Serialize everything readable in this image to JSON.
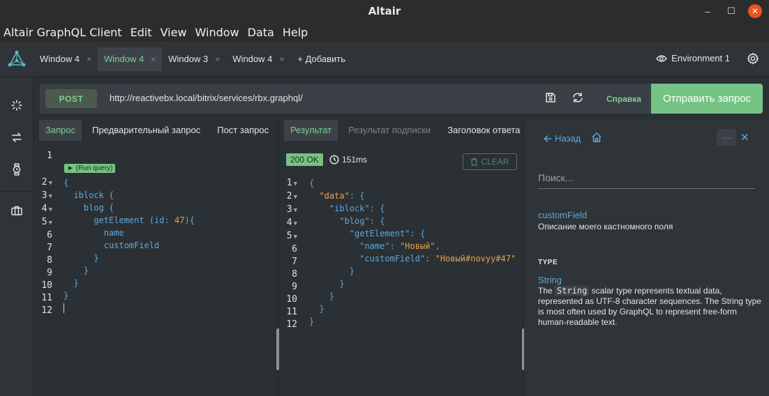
{
  "window": {
    "title": "Altair",
    "minimize": "–",
    "maximize": "☐",
    "close": "✕"
  },
  "menu": [
    "Altair GraphQL Client",
    "Edit",
    "View",
    "Window",
    "Data",
    "Help"
  ],
  "tabs": [
    {
      "label": "Window 4",
      "active": false
    },
    {
      "label": "Window 4",
      "active": true
    },
    {
      "label": "Window 3",
      "active": false
    },
    {
      "label": "Window 4",
      "active": false
    }
  ],
  "tab_close": "×",
  "add_tab": "+ Добавить",
  "environment": "Environment 1",
  "request": {
    "method": "POST",
    "url": "http://reactivebx.local/bitrix/services/rbx.graphql/",
    "help": "Справка",
    "send": "Отправить запрос"
  },
  "query_pane": {
    "tabs": [
      "Запрос",
      "Предварительный запрос",
      "Пост запрос"
    ],
    "run_query": "► (Run query)",
    "line_numbers": [
      "1",
      "2",
      "3",
      "4",
      "5",
      "6",
      "7",
      "8",
      "9",
      "10",
      "11",
      "12"
    ]
  },
  "result_pane": {
    "tabs": [
      "Результат",
      "Результат подписки",
      "Заголовок ответа"
    ],
    "status": "200 OK",
    "time": "151ms",
    "clear": "CLEAR",
    "line_numbers": [
      "1",
      "2",
      "3",
      "4",
      "5",
      "6",
      "7",
      "8",
      "9",
      "10",
      "11",
      "12"
    ]
  },
  "docs": {
    "back": "Назад",
    "more": "···",
    "close": "✕",
    "search_placeholder": "Поиск...",
    "field_name": "customField",
    "field_desc": "Описание моего кастномного поля",
    "type_heading": "TYPE",
    "type_name": "String",
    "type_desc_pre": "The ",
    "type_desc_code": "String",
    "type_desc_post": " scalar type represents textual data, represented as UTF-8 character sequences. The String type is most often used by GraphQL to represent free-form human-readable text."
  },
  "colors": {
    "accent": "#75c383",
    "link": "#5ea8d9",
    "string": "#e5a24e"
  }
}
